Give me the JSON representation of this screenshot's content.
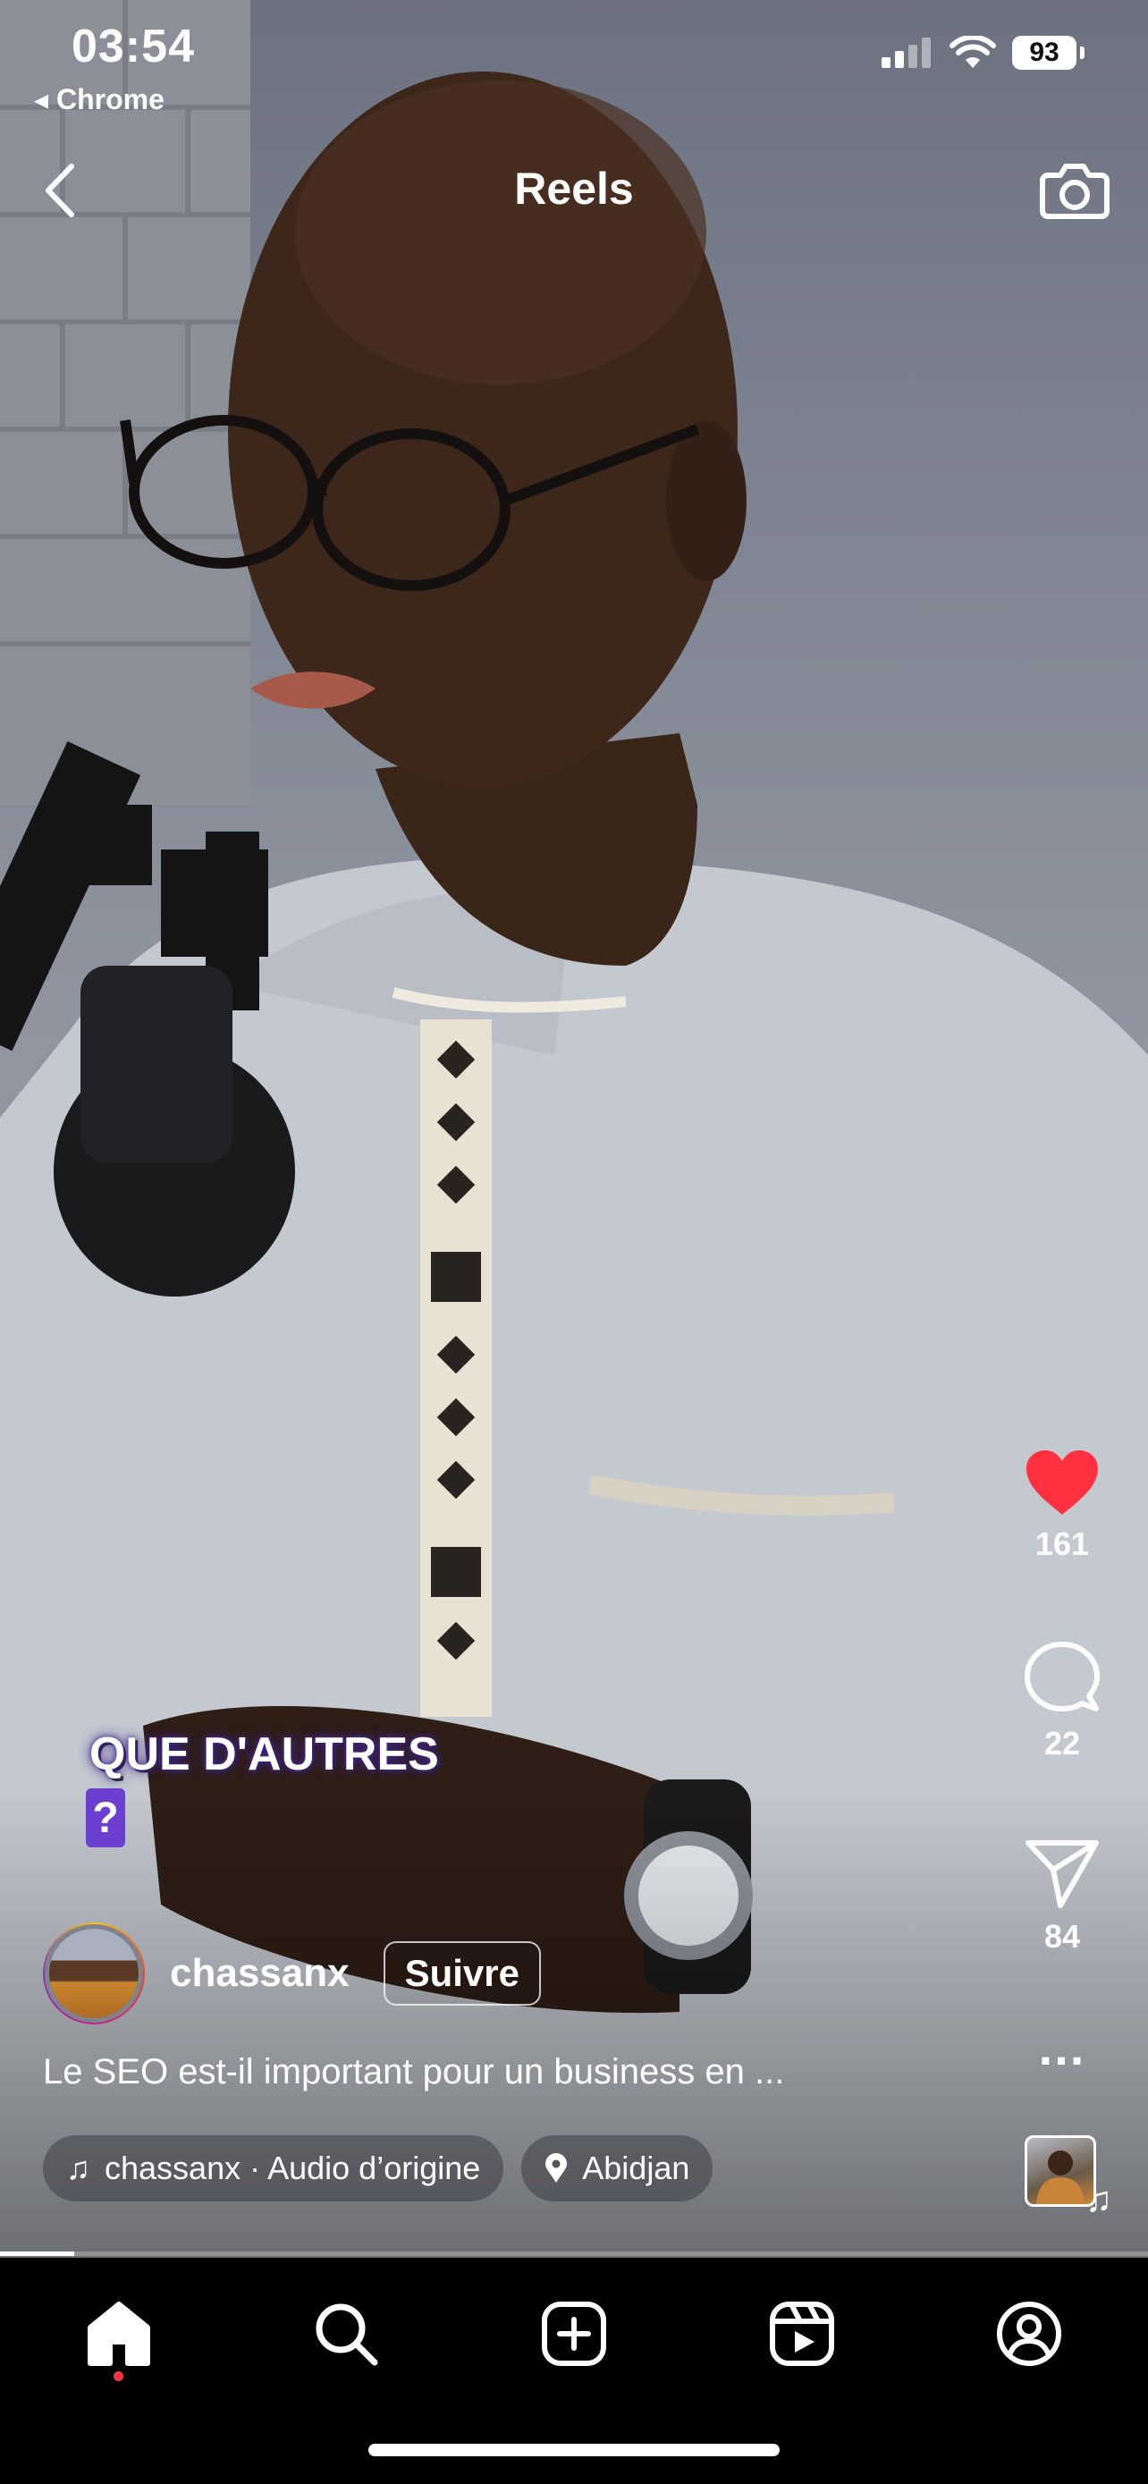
{
  "status_bar": {
    "time": "03:54",
    "back_label": "◂ Chrome",
    "battery": "93"
  },
  "header": {
    "title": "Reels"
  },
  "video": {
    "overlay_line1": "QUE D'AUTRES",
    "overlay_line2": "?"
  },
  "actions": {
    "likes": "161",
    "comments": "22",
    "shares": "84",
    "more": "..."
  },
  "post": {
    "username": "chassanx",
    "follow_label": "Suivre",
    "caption": "Le SEO est-il important pour un business en ...",
    "audio_label": "chassanx · Audio d’origine",
    "location_label": "Abidjan"
  },
  "playback": {
    "progress_fraction": 0.065
  },
  "colors": {
    "like_red": "#ff3040",
    "overlay_purple": "#6b3fd0",
    "tab_bar": "#000000"
  },
  "tabs": [
    {
      "name": "home",
      "active": true
    },
    {
      "name": "search"
    },
    {
      "name": "create"
    },
    {
      "name": "reels"
    },
    {
      "name": "profile"
    }
  ]
}
